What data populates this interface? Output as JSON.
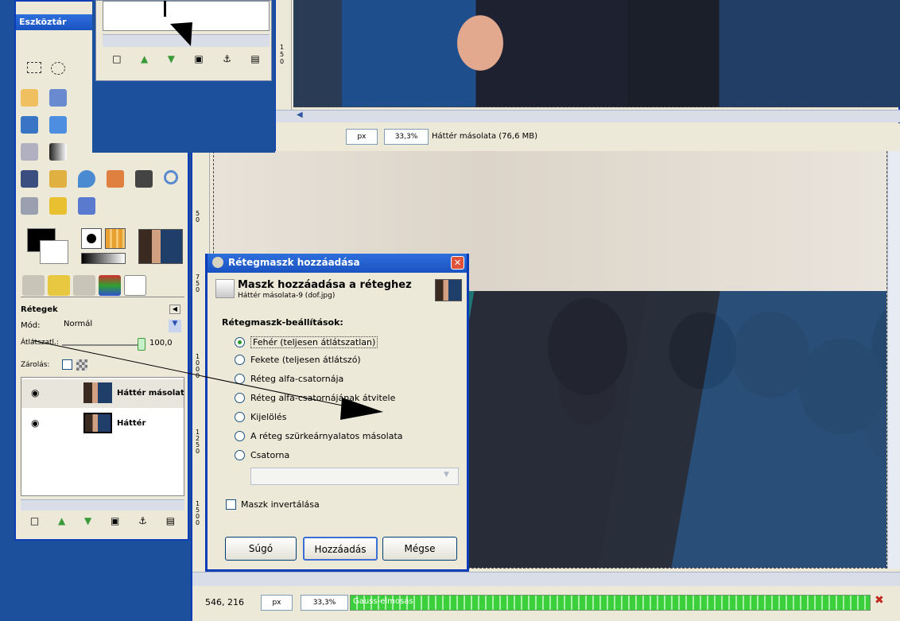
{
  "toolbox": {
    "title": "Eszköztár"
  },
  "layers": {
    "heading": "Rétegek",
    "mode_label": "Mód:",
    "mode_value": "Normál",
    "opacity_label": "Átlátszatl.:",
    "opacity_value": "100,0",
    "lock_label": "Zárolás:",
    "items": [
      {
        "name": "Háttér másolat"
      },
      {
        "name": "Háttér"
      }
    ]
  },
  "top_image": {
    "unit": "px",
    "zoom": "33,3%",
    "status": "Háttér másolata (76,6 MB)",
    "ruler_v": "150"
  },
  "main_image": {
    "coords": "546, 216",
    "unit": "px",
    "zoom": "33,3%",
    "progress_label": "Gauss-elmosás",
    "ruler_v": [
      "50",
      "750",
      "1000",
      "1250",
      "1500"
    ],
    "progress": 1.0
  },
  "dialog": {
    "title": "Rétegmaszk hozzáadása",
    "heading": "Maszk hozzáadása a réteghez",
    "subheading": "Háttér másolata-9 (dof.jpg)",
    "section": "Rétegmaszk-beállítások:",
    "options": [
      "Fehér (teljesen átlátszatlan)",
      "Fekete (teljesen átlátszó)",
      "Réteg alfa-csatornája",
      "Réteg alfa-csatornájának átvitele",
      "Kijelölés",
      "A réteg szürkeárnyalatos másolata",
      "Csatorna"
    ],
    "selected": 0,
    "invert": "Maszk invertálása",
    "buttons": {
      "help": "Súgó",
      "add": "Hozzáadás",
      "cancel": "Mégse"
    }
  },
  "colors": {
    "desktop": "#1c4f9c",
    "titlebar": "#1a53c2",
    "progress": "#3ccf3c"
  }
}
